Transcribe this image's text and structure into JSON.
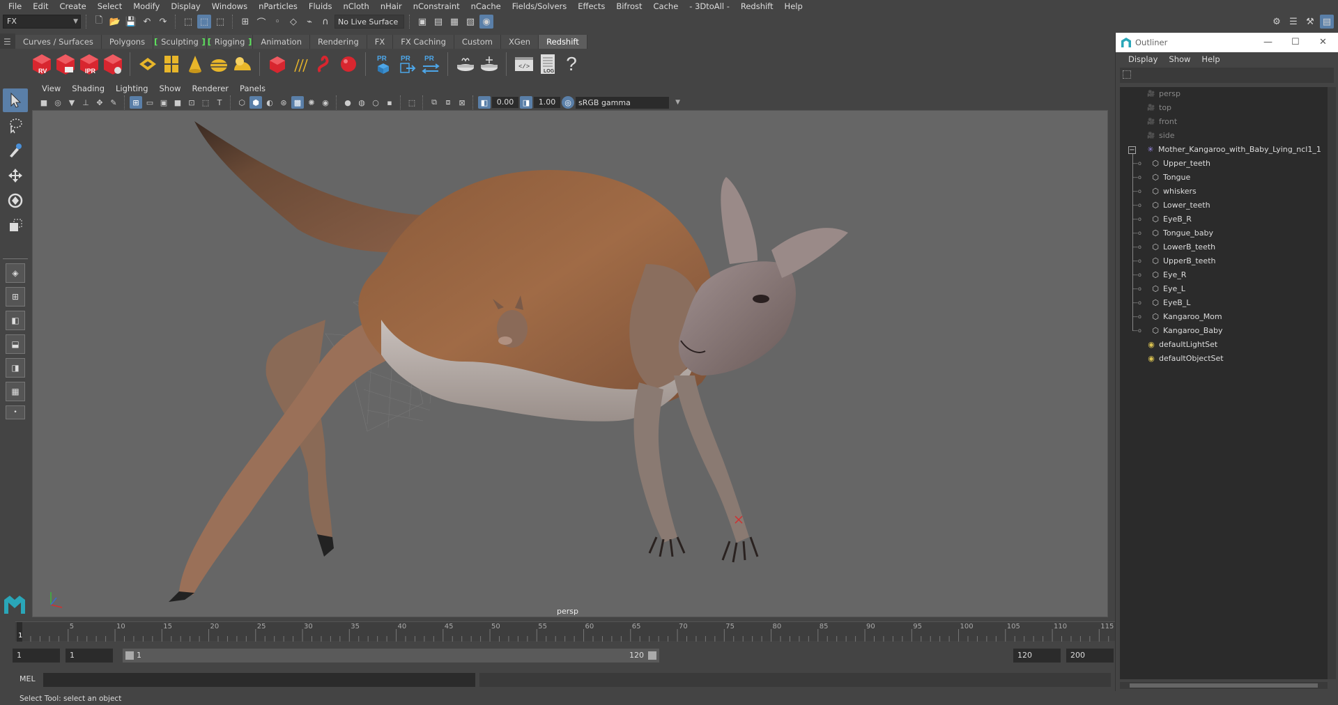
{
  "menubar": [
    "File",
    "Edit",
    "Create",
    "Select",
    "Modify",
    "Display",
    "Windows",
    "nParticles",
    "Fluids",
    "nCloth",
    "nHair",
    "nConstraint",
    "nCache",
    "Fields/Solvers",
    "Effects",
    "Bifrost",
    "Cache",
    "- 3DtoAll -",
    "Redshift",
    "Help"
  ],
  "status": {
    "mode": "FX",
    "live_surface": "No Live Surface"
  },
  "shelf": {
    "tabs": [
      "Curves / Surfaces",
      "Polygons",
      "Sculpting",
      "Rigging",
      "Animation",
      "Rendering",
      "FX",
      "FX Caching",
      "Custom",
      "XGen",
      "Redshift"
    ],
    "active_tab": "Redshift",
    "icon_labels": [
      "RV",
      "IPR",
      "PR",
      "PR",
      "PR",
      "LOG",
      "?"
    ]
  },
  "viewport": {
    "menu": [
      "View",
      "Shading",
      "Lighting",
      "Show",
      "Renderer",
      "Panels"
    ],
    "exposure": "0.00",
    "gamma": "1.00",
    "color_space": "sRGB gamma",
    "camera_label": "persp"
  },
  "timeline": {
    "ticks": [
      "5",
      "10",
      "15",
      "20",
      "25",
      "30",
      "35",
      "40",
      "45",
      "50",
      "55",
      "60",
      "65",
      "70",
      "75",
      "80",
      "85",
      "90",
      "95",
      "100",
      "105",
      "110",
      "115"
    ],
    "current_frame": "1",
    "start": "1",
    "playback_start": "1",
    "range_start_label": "1",
    "range_end_label": "120",
    "playback_end": "120",
    "end": "200"
  },
  "cmdline": {
    "label": "MEL",
    "help": "Select Tool: select an object"
  },
  "outliner": {
    "title": "Outliner",
    "menu": [
      "Display",
      "Show",
      "Help"
    ],
    "cameras": [
      "persp",
      "top",
      "front",
      "side"
    ],
    "group": "Mother_Kangaroo_with_Baby_Lying_ncl1_1",
    "children": [
      "Upper_teeth",
      "Tongue",
      "whiskers",
      "Lower_teeth",
      "EyeB_R",
      "Tongue_baby",
      "LowerB_teeth",
      "UpperB_teeth",
      "Eye_R",
      "Eye_L",
      "EyeB_L",
      "Kangaroo_Mom",
      "Kangaroo_Baby"
    ],
    "sets": [
      "defaultLightSet",
      "defaultObjectSet"
    ]
  },
  "colors": {
    "accent": "#5a7fa8",
    "viewport_bg": "#666666",
    "shelf_red": "#d8262f",
    "shelf_yellow": "#e8b62a",
    "outliner_teal": "#2aa6b8"
  }
}
